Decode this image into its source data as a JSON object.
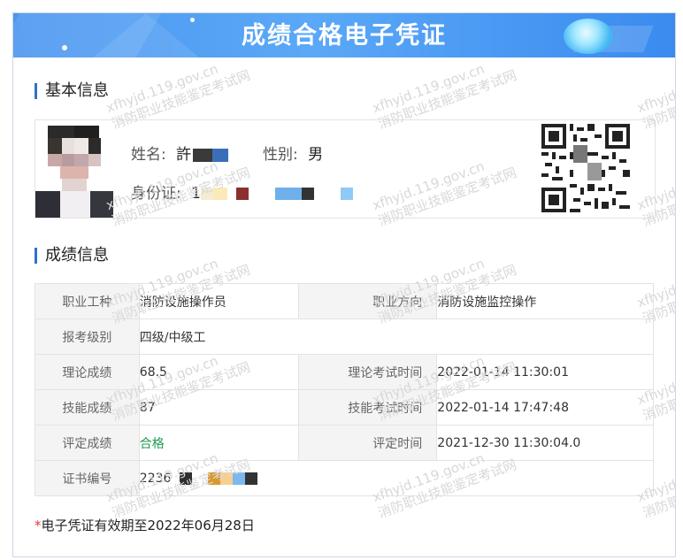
{
  "banner": {
    "title": "成绩合格电子凭证"
  },
  "watermark": {
    "line1": "xfhyjd.119.gov.cn",
    "line2": "消防职业技能鉴定考试网"
  },
  "basic": {
    "section_title": "基本信息",
    "name_label": "姓名:",
    "name_value": "許",
    "gender_label": "性别:",
    "gender_value": "男",
    "id_label": "身份证:",
    "id_value": "1"
  },
  "grades": {
    "section_title": "成绩信息",
    "rows": [
      {
        "l1": "职业工种",
        "v1": "消防设施操作员",
        "l2": "职业方向",
        "v2": "消防设施监控操作"
      },
      {
        "l1": "报考级别",
        "v1": "四级/中级工"
      },
      {
        "l1": "理论成绩",
        "v1": "68.5",
        "l2": "理论考试时间",
        "v2": "2022-01-14 11:30:01"
      },
      {
        "l1": "技能成绩",
        "v1": "87",
        "l2": "技能考试时间",
        "v2": "2022-01-14 17:47:48"
      },
      {
        "l1": "评定成绩",
        "v1": "合格",
        "l2": "评定时间",
        "v2": "2021-12-30 11:30:04.0"
      },
      {
        "l1": "证书编号",
        "v1": "2236"
      }
    ]
  },
  "validity": {
    "star": "*",
    "text": "电子凭证有效期至2022年06月28日"
  },
  "colors": {
    "accent": "#2f6fd1",
    "banner": "#4b96f0",
    "pass": "#1e9b54",
    "star": "#e33333"
  }
}
